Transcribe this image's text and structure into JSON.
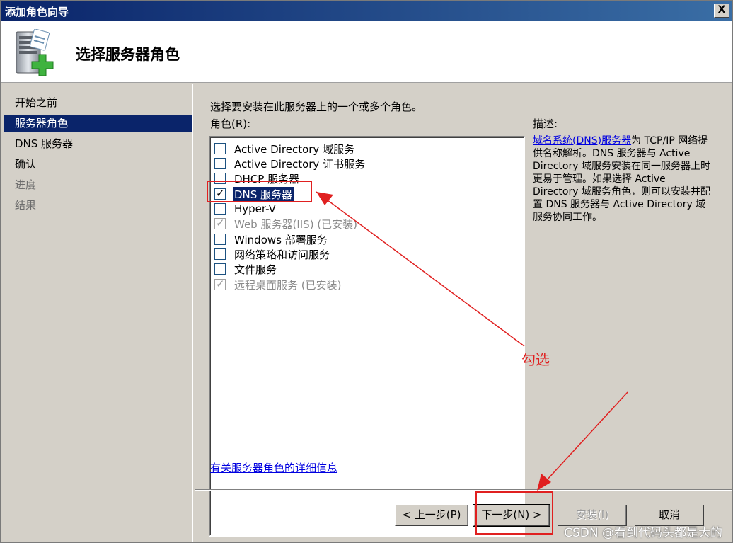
{
  "window": {
    "title": "添加角色向导",
    "close_glyph": "X"
  },
  "header": {
    "title": "选择服务器角色",
    "icon": "server-add-icon"
  },
  "sidebar": {
    "items": [
      {
        "label": "开始之前",
        "state": "normal"
      },
      {
        "label": "服务器角色",
        "state": "active"
      },
      {
        "label": "DNS 服务器",
        "state": "normal"
      },
      {
        "label": "确认",
        "state": "normal"
      },
      {
        "label": "进度",
        "state": "disabled"
      },
      {
        "label": "结果",
        "state": "disabled"
      }
    ]
  },
  "main": {
    "instruction": "选择要安装在此服务器上的一个或多个角色。",
    "roles_label": "角色(R):",
    "roles": [
      {
        "label": "Active Directory 域服务",
        "checked": false,
        "disabled": false,
        "selected": false
      },
      {
        "label": "Active Directory 证书服务",
        "checked": false,
        "disabled": false,
        "selected": false
      },
      {
        "label": "DHCP 服务器",
        "checked": false,
        "disabled": false,
        "selected": false
      },
      {
        "label": "DNS 服务器",
        "checked": true,
        "disabled": false,
        "selected": true
      },
      {
        "label": "Hyper-V",
        "checked": false,
        "disabled": false,
        "selected": false
      },
      {
        "label": "Web 服务器(IIS)  (已安装)",
        "checked": true,
        "disabled": true,
        "selected": false
      },
      {
        "label": "Windows 部署服务",
        "checked": false,
        "disabled": false,
        "selected": false
      },
      {
        "label": "网络策略和访问服务",
        "checked": false,
        "disabled": false,
        "selected": false
      },
      {
        "label": "文件服务",
        "checked": false,
        "disabled": false,
        "selected": false
      },
      {
        "label": "远程桌面服务  (已安装)",
        "checked": true,
        "disabled": true,
        "selected": false
      }
    ],
    "description_label": "描述:",
    "description_link": "域名系统(DNS)服务器",
    "description_text": "为 TCP/IP 网络提供名称解析。DNS 服务器与 Active Directory 域服务安装在同一服务器上时更易于管理。如果选择 Active Directory 域服务角色，则可以安装并配置 DNS 服务器与 Active Directory 域服务协同工作。",
    "detail_link": "有关服务器角色的详细信息"
  },
  "buttons": {
    "prev": "< 上一步(P)",
    "next": "下一步(N) >",
    "install": "安装(I)",
    "cancel": "取消"
  },
  "annotation": {
    "text": "勾选",
    "color": "#e02020"
  },
  "watermark": "CSDN @看到代码头都是大的"
}
